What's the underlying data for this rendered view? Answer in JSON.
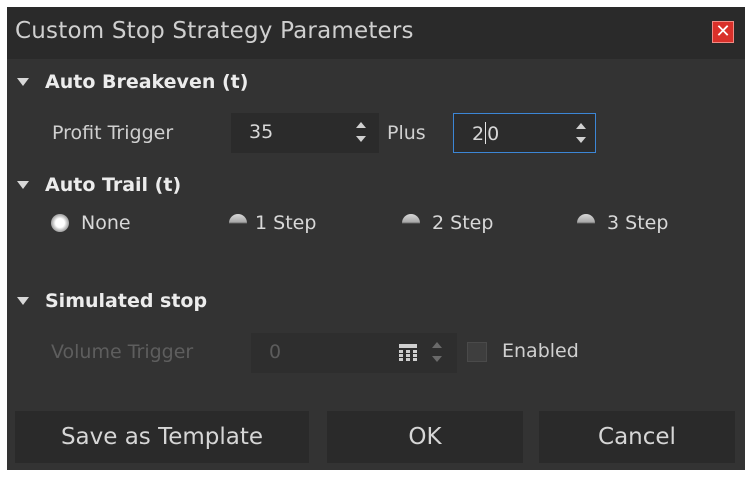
{
  "dialog": {
    "title": "Custom Stop Strategy Parameters",
    "close_glyph": "✕"
  },
  "auto_breakeven": {
    "header": "Auto Breakeven (t)",
    "profit_trigger_label": "Profit Trigger",
    "profit_trigger_value": "35",
    "plus_label": "Plus",
    "plus_value_before_cursor": "2",
    "plus_value_after_cursor": "0"
  },
  "auto_trail": {
    "header": "Auto Trail (t)",
    "options": [
      "None",
      "1 Step",
      "2 Step",
      "3 Step"
    ],
    "selected": "None"
  },
  "simulated_stop": {
    "header": "Simulated stop",
    "volume_trigger_label": "Volume Trigger",
    "volume_trigger_value": "0",
    "enabled_label": "Enabled",
    "enabled_checked": false
  },
  "buttons": {
    "save_template": "Save as Template",
    "ok": "OK",
    "cancel": "Cancel"
  },
  "colors": {
    "background": "#333333",
    "titlebar": "#2a2a2a",
    "focus_border": "#3c86d6",
    "close_button": "#d9302a"
  }
}
